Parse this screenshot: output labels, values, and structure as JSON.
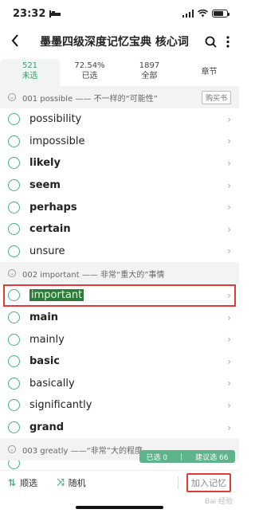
{
  "status": {
    "time": "23:32"
  },
  "nav": {
    "back_icon": "chevron-left-icon",
    "title": "墨墨四级深度记忆宝典 核心词"
  },
  "tabs": [
    {
      "count": "521",
      "label": "未选"
    },
    {
      "count": "72.54%",
      "label": "已选"
    },
    {
      "count": "1897",
      "label": "全部"
    },
    {
      "count": "",
      "label": "章节"
    }
  ],
  "sections": [
    {
      "title": "001 possible —— 不一样的“可能性”",
      "buy_label": "购买书",
      "words": [
        "possibility",
        "impossible",
        "likely",
        "seem",
        "perhaps",
        "certain",
        "unsure"
      ]
    },
    {
      "title": "002 important —— 非常“重大的”事情",
      "words": [
        "important",
        "main",
        "mainly",
        "basic",
        "basically",
        "significantly",
        "grand"
      ]
    },
    {
      "title": "003 greatly ——“非常”大的程度"
    }
  ],
  "badge": {
    "selected": "已选 0",
    "suggested": "建议选 66"
  },
  "toolbar": {
    "filter_label": "顺选",
    "random_label": "随机",
    "add_label": "加入记忆"
  },
  "watermark": "Bai 经验"
}
